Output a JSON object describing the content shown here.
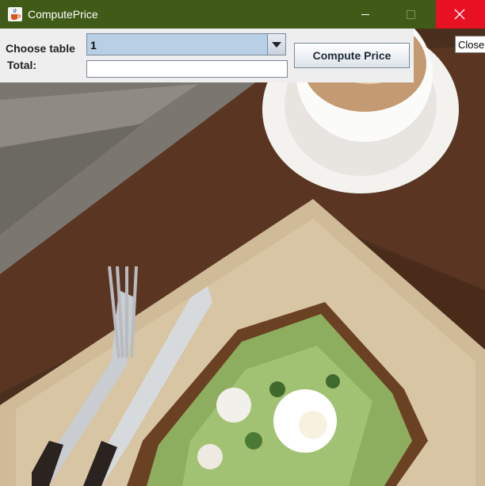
{
  "window": {
    "title": "ComputePrice",
    "icon": "java-cup-icon",
    "controls": {
      "minimize": "minimize-icon",
      "maximize": "maximize-icon",
      "close": "close-icon"
    },
    "titlebar_color": "#405b18",
    "close_hover_color": "#e81123"
  },
  "form": {
    "table_label": "Choose table",
    "table_selected": "1",
    "total_label": "Total:",
    "total_value": "",
    "compute_button": "Compute Price"
  },
  "tooltip": {
    "text": "Close"
  },
  "background": {
    "subject": "avocado-toast-and-coffee-photo"
  }
}
